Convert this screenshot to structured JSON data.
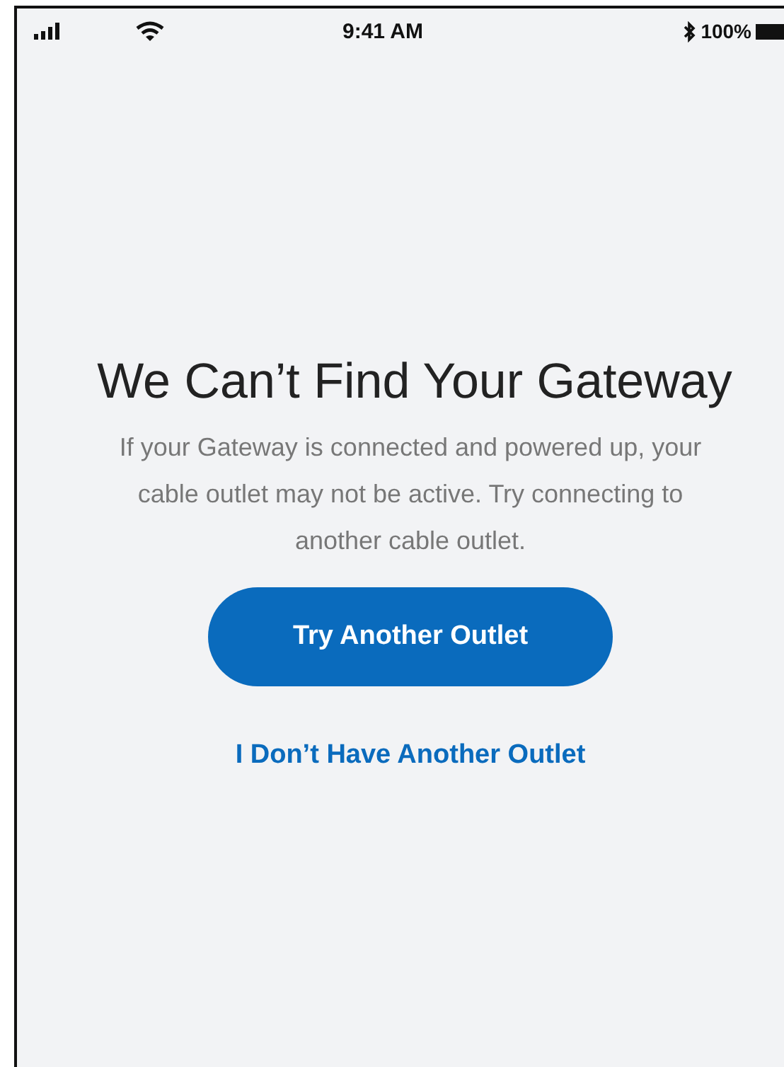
{
  "status_bar": {
    "time": "9:41 AM",
    "battery": "100%"
  },
  "title": "We Can’t Find Your Gateway",
  "message": "If your Gateway is connected and powered up, your cable outlet may not be active. Try connecting to another cable outlet.",
  "primary_button": "Try Another Outlet",
  "secondary_link": "I Don’t Have Another Outlet"
}
